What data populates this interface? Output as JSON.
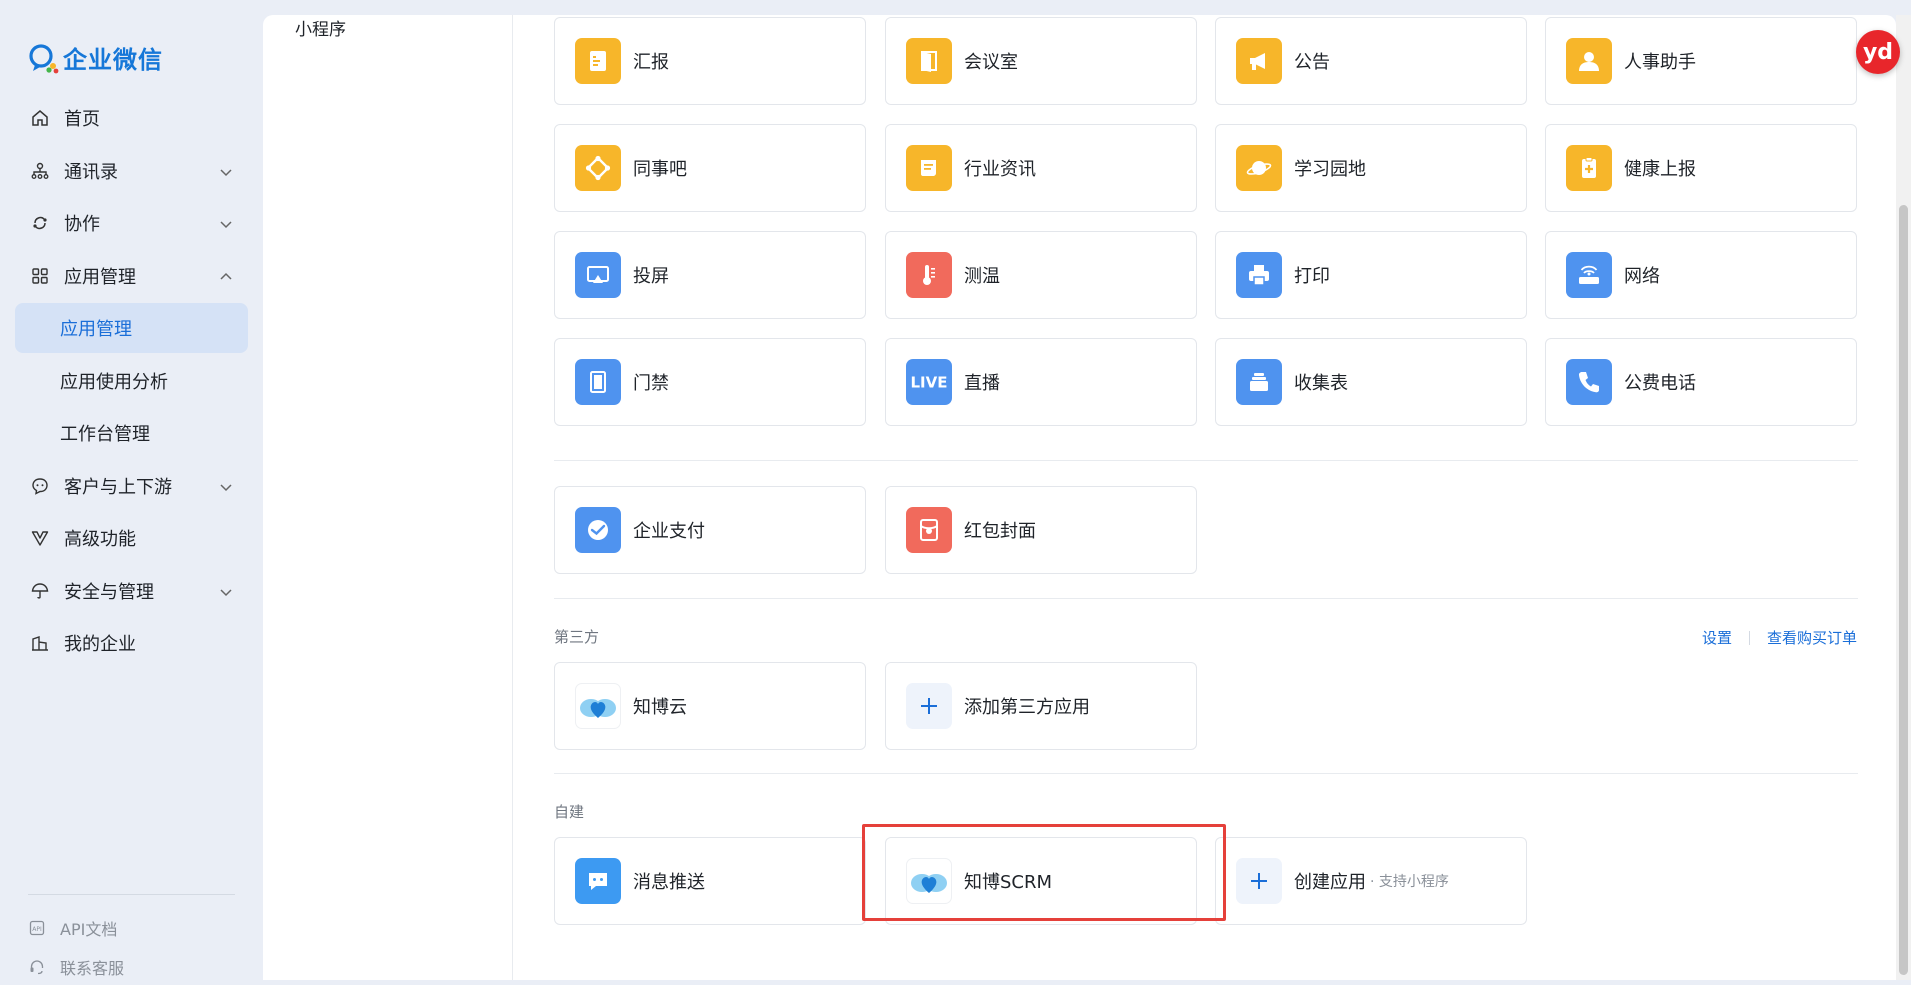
{
  "brand": {
    "logo_text": "企业微信",
    "accent": "#1a6ed8"
  },
  "sidebar": {
    "items": [
      {
        "label": "首页",
        "icon": "home-icon"
      },
      {
        "label": "通讯录",
        "icon": "org-chart-icon",
        "expandable": true
      },
      {
        "label": "协作",
        "icon": "collab-icon",
        "expandable": true
      },
      {
        "label": "应用管理",
        "icon": "apps-grid-icon",
        "expanded": true
      },
      {
        "label": "应用管理",
        "sub": true,
        "active": true
      },
      {
        "label": "应用使用分析",
        "sub": true
      },
      {
        "label": "工作台管理",
        "sub": true
      },
      {
        "label": "客户与上下游",
        "icon": "chat-bubble-icon",
        "expandable": true
      },
      {
        "label": "高级功能",
        "icon": "vip-icon"
      },
      {
        "label": "安全与管理",
        "icon": "umbrella-icon",
        "expandable": true
      },
      {
        "label": "我的企业",
        "icon": "building-icon"
      }
    ],
    "footer": [
      {
        "label": "API文档",
        "icon": "api-doc-icon"
      },
      {
        "label": "联系客服",
        "icon": "headset-icon"
      }
    ]
  },
  "left_column": {
    "label": "小程序"
  },
  "apps_builtin": [
    {
      "name": "汇报",
      "icon": "report-icon",
      "color": "#f7b62a"
    },
    {
      "name": "会议室",
      "icon": "door-icon",
      "color": "#f7b62a"
    },
    {
      "name": "公告",
      "icon": "megaphone-icon",
      "color": "#f7b62a"
    },
    {
      "name": "人事助手",
      "icon": "person-icon",
      "color": "#f7b62a"
    },
    {
      "name": "同事吧",
      "icon": "community-icon",
      "color": "#f7b62a"
    },
    {
      "name": "行业资讯",
      "icon": "scroll-icon",
      "color": "#f7b62a"
    },
    {
      "name": "学习园地",
      "icon": "planet-icon",
      "color": "#f7b62a"
    },
    {
      "name": "健康上报",
      "icon": "health-icon",
      "color": "#f7b62a"
    },
    {
      "name": "投屏",
      "icon": "cast-icon",
      "color": "#4f93ef"
    },
    {
      "name": "测温",
      "icon": "thermometer-icon",
      "color": "#f16a5c"
    },
    {
      "name": "打印",
      "icon": "printer-icon",
      "color": "#4f93ef"
    },
    {
      "name": "网络",
      "icon": "router-icon",
      "color": "#4f93ef"
    },
    {
      "name": "门禁",
      "icon": "gate-icon",
      "color": "#4f93ef"
    },
    {
      "name": "直播",
      "icon": "live-icon",
      "color": "#4f93ef"
    },
    {
      "name": "收集表",
      "icon": "inbox-icon",
      "color": "#4f93ef"
    },
    {
      "name": "公费电话",
      "icon": "phone-icon",
      "color": "#4f93ef"
    }
  ],
  "apps_payment": [
    {
      "name": "企业支付",
      "icon": "pay-icon",
      "color": "#4f93ef"
    },
    {
      "name": "红包封面",
      "icon": "red-packet-icon",
      "color": "#f16a5c"
    }
  ],
  "third_party": {
    "label": "第三方",
    "settings_link": "设置",
    "orders_link": "查看购买订单",
    "apps": [
      {
        "name": "知博云",
        "icon": "zhibo-cloud-icon"
      }
    ],
    "add_label": "添加第三方应用"
  },
  "self_built": {
    "label": "自建",
    "apps": [
      {
        "name": "消息推送",
        "icon": "message-push-icon",
        "color": "#3d9af2"
      },
      {
        "name": "知博SCRM",
        "icon": "zhibo-scrm-icon"
      }
    ],
    "create_label": "创建应用",
    "create_note": "· 支持小程序"
  },
  "overlay_badge": "yd"
}
